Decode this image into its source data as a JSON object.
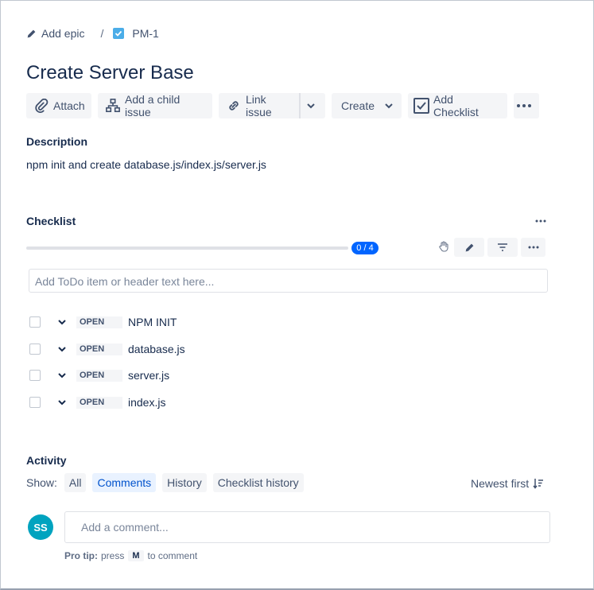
{
  "breadcrumb": {
    "epic_label": "Add epic",
    "separator": "/",
    "issue_key": "PM-1"
  },
  "issue": {
    "title": "Create Server Base"
  },
  "toolbar": {
    "attach": "Attach",
    "child_issue": "Add a child issue",
    "link_issue": "Link issue",
    "create": "Create",
    "add_checklist": "Add Checklist"
  },
  "description": {
    "heading": "Description",
    "text": "npm init and create database.js/index.js/server.js"
  },
  "checklist": {
    "heading": "Checklist",
    "progress_text": "0 / 4",
    "progress_fraction": 0,
    "input_placeholder": "Add ToDo item or header text here...",
    "items": [
      {
        "status": "OPEN",
        "label": "NPM INIT"
      },
      {
        "status": "OPEN",
        "label": "database.js"
      },
      {
        "status": "OPEN",
        "label": "server.js"
      },
      {
        "status": "OPEN",
        "label": "index.js"
      }
    ]
  },
  "activity": {
    "heading": "Activity",
    "show_label": "Show:",
    "filters": [
      "All",
      "Comments",
      "History",
      "Checklist history"
    ],
    "selected_filter": "Comments",
    "sort_label": "Newest first",
    "avatar_initials": "SS",
    "comment_placeholder": "Add a comment...",
    "tip_prefix": "Pro tip:",
    "tip_press": "press",
    "tip_key": "M",
    "tip_suffix": "to comment"
  },
  "colors": {
    "accent": "#0052cc",
    "badge": "#0065ff",
    "avatar": "#00a3bf",
    "issue_icon": "#4bade8"
  }
}
